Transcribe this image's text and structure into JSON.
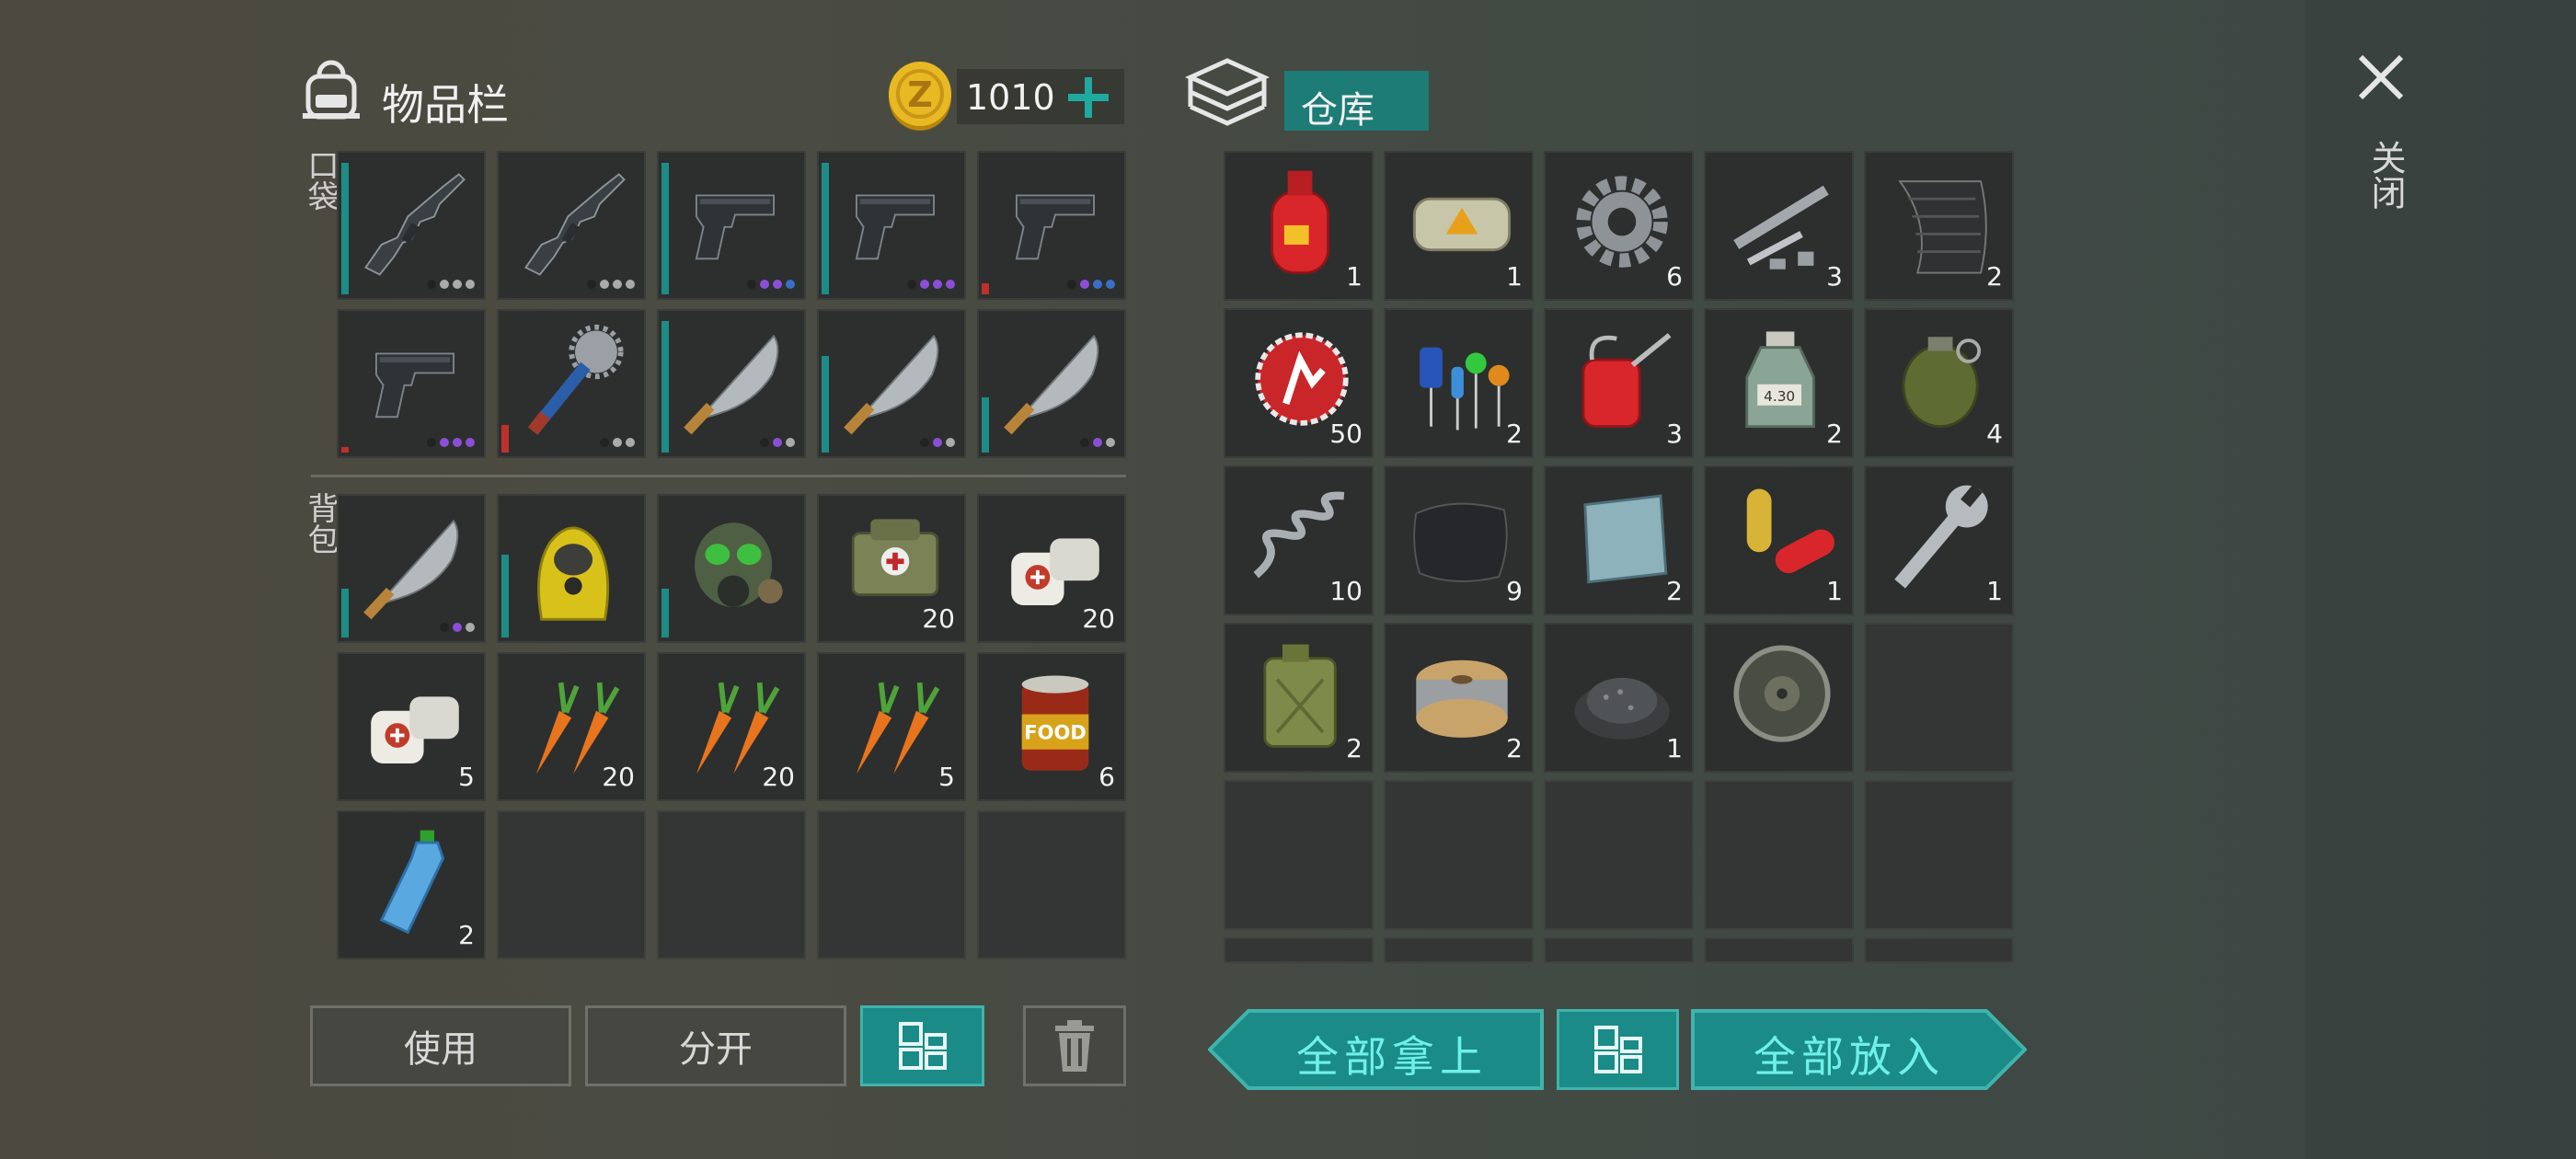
{
  "inventory": {
    "title": "物品栏",
    "coins": "1010",
    "pocket_label": "口袋",
    "backpack_label": "背包"
  },
  "storage": {
    "title": "仓库"
  },
  "close_label": "关闭",
  "buttons": {
    "use": "使用",
    "split": "分开",
    "take_all": "全部拿上",
    "put_all": "全部放入"
  },
  "colors": {
    "teal": "#1a8b86",
    "slot": "#2c2f2d",
    "gold": "#e8b923"
  },
  "pocket": [
    {
      "icon": "rifle-icon",
      "bar": "teal",
      "bar_level": 0.95,
      "dots": [
        "#222",
        "#aaa",
        "#aaa",
        "#aaa"
      ]
    },
    {
      "icon": "rifle-icon",
      "bar": "none",
      "bar_level": 0,
      "dots": [
        "#222",
        "#aaa",
        "#aaa",
        "#aaa"
      ]
    },
    {
      "icon": "pistol-icon",
      "bar": "teal",
      "bar_level": 0.95,
      "dots": [
        "#222",
        "#8a4fd6",
        "#8a4fd6",
        "#3b6ec9"
      ]
    },
    {
      "icon": "pistol-icon",
      "bar": "teal",
      "bar_level": 0.95,
      "dots": [
        "#222",
        "#8a4fd6",
        "#8a4fd6",
        "#8a4fd6"
      ]
    },
    {
      "icon": "pistol-icon",
      "bar": "red",
      "bar_level": 0.08,
      "dots": [
        "#222",
        "#8a4fd6",
        "#3b6ec9",
        "#3b6ec9"
      ]
    },
    {
      "icon": "pistol-icon",
      "bar": "red",
      "bar_level": 0.04,
      "dots": [
        "#222",
        "#8a4fd6",
        "#8a4fd6",
        "#8a4fd6"
      ]
    },
    {
      "icon": "saw-club-icon",
      "bar": "red",
      "bar_level": 0.2,
      "dots": [
        "#222",
        "#aaa",
        "#aaa"
      ]
    },
    {
      "icon": "machete-icon",
      "bar": "teal",
      "bar_level": 0.95,
      "dots": [
        "#222",
        "#8a4fd6",
        "#aaa"
      ]
    },
    {
      "icon": "machete-icon",
      "bar": "teal",
      "bar_level": 0.7,
      "dots": [
        "#222",
        "#8a4fd6",
        "#aaa"
      ]
    },
    {
      "icon": "machete-icon",
      "bar": "teal",
      "bar_level": 0.4,
      "dots": [
        "#222",
        "#8a4fd6",
        "#aaa"
      ]
    }
  ],
  "backpack": [
    {
      "icon": "machete-icon",
      "bar": "teal",
      "bar_level": 0.35,
      "dots": [
        "#222",
        "#8a4fd6",
        "#aaa"
      ],
      "qty": ""
    },
    {
      "icon": "hazmat-suit-icon",
      "bar": "teal",
      "bar_level": 0.6,
      "dots": [],
      "qty": ""
    },
    {
      "icon": "gas-mask-icon",
      "bar": "teal",
      "bar_level": 0.35,
      "dots": [],
      "qty": ""
    },
    {
      "icon": "medkit-bag-icon",
      "bar": "none",
      "bar_level": 0,
      "dots": [],
      "qty": "20"
    },
    {
      "icon": "bandage-icon",
      "bar": "none",
      "bar_level": 0,
      "dots": [],
      "qty": "20"
    },
    {
      "icon": "bandage-icon",
      "bar": "none",
      "bar_level": 0,
      "dots": [],
      "qty": "5"
    },
    {
      "icon": "carrot-icon",
      "bar": "none",
      "bar_level": 0,
      "dots": [],
      "qty": "20"
    },
    {
      "icon": "carrot-icon",
      "bar": "none",
      "bar_level": 0,
      "dots": [],
      "qty": "20"
    },
    {
      "icon": "carrot-icon",
      "bar": "none",
      "bar_level": 0,
      "dots": [],
      "qty": "5"
    },
    {
      "icon": "canned-food-icon",
      "bar": "none",
      "bar_level": 0,
      "dots": [],
      "qty": "6",
      "label": "FOOD"
    },
    {
      "icon": "water-bottle-icon",
      "bar": "none",
      "bar_level": 0,
      "dots": [],
      "qty": "2"
    },
    {
      "icon": "",
      "bar": "none",
      "bar_level": 0,
      "dots": [],
      "qty": ""
    },
    {
      "icon": "",
      "bar": "none",
      "bar_level": 0,
      "dots": [],
      "qty": ""
    },
    {
      "icon": "",
      "bar": "none",
      "bar_level": 0,
      "dots": [],
      "qty": ""
    },
    {
      "icon": "",
      "bar": "none",
      "bar_level": 0,
      "dots": [],
      "qty": ""
    }
  ],
  "storage_items": [
    {
      "icon": "gas-cylinder-icon",
      "qty": "1"
    },
    {
      "icon": "explosive-block-icon",
      "qty": "1"
    },
    {
      "icon": "gear-icon",
      "qty": "6"
    },
    {
      "icon": "pipe-parts-icon",
      "qty": "3"
    },
    {
      "icon": "carbon-sheet-icon",
      "qty": "2"
    },
    {
      "icon": "bottle-cap-icon",
      "qty": "50"
    },
    {
      "icon": "electronic-components-icon",
      "qty": "2"
    },
    {
      "icon": "oil-can-icon",
      "qty": "3"
    },
    {
      "icon": "chemical-jar-icon",
      "qty": "2",
      "label": "4.30"
    },
    {
      "icon": "grenade-icon",
      "qty": "4"
    },
    {
      "icon": "spring-icon",
      "qty": "10"
    },
    {
      "icon": "leather-icon",
      "qty": "9"
    },
    {
      "icon": "metal-plate-icon",
      "qty": "2"
    },
    {
      "icon": "pills-icon",
      "qty": "1"
    },
    {
      "icon": "wrench-icon",
      "qty": "1"
    },
    {
      "icon": "jerrycan-icon",
      "qty": "2"
    },
    {
      "icon": "wire-spool-icon",
      "qty": "2"
    },
    {
      "icon": "gunpowder-icon",
      "qty": "1"
    },
    {
      "icon": "flywheel-icon",
      "qty": ""
    },
    {
      "icon": "",
      "qty": ""
    },
    {
      "icon": "",
      "qty": ""
    },
    {
      "icon": "",
      "qty": ""
    },
    {
      "icon": "",
      "qty": ""
    },
    {
      "icon": "",
      "qty": ""
    },
    {
      "icon": "",
      "qty": ""
    },
    {
      "icon": "",
      "qty": ""
    },
    {
      "icon": "",
      "qty": ""
    },
    {
      "icon": "",
      "qty": ""
    },
    {
      "icon": "",
      "qty": ""
    },
    {
      "icon": "",
      "qty": ""
    }
  ]
}
